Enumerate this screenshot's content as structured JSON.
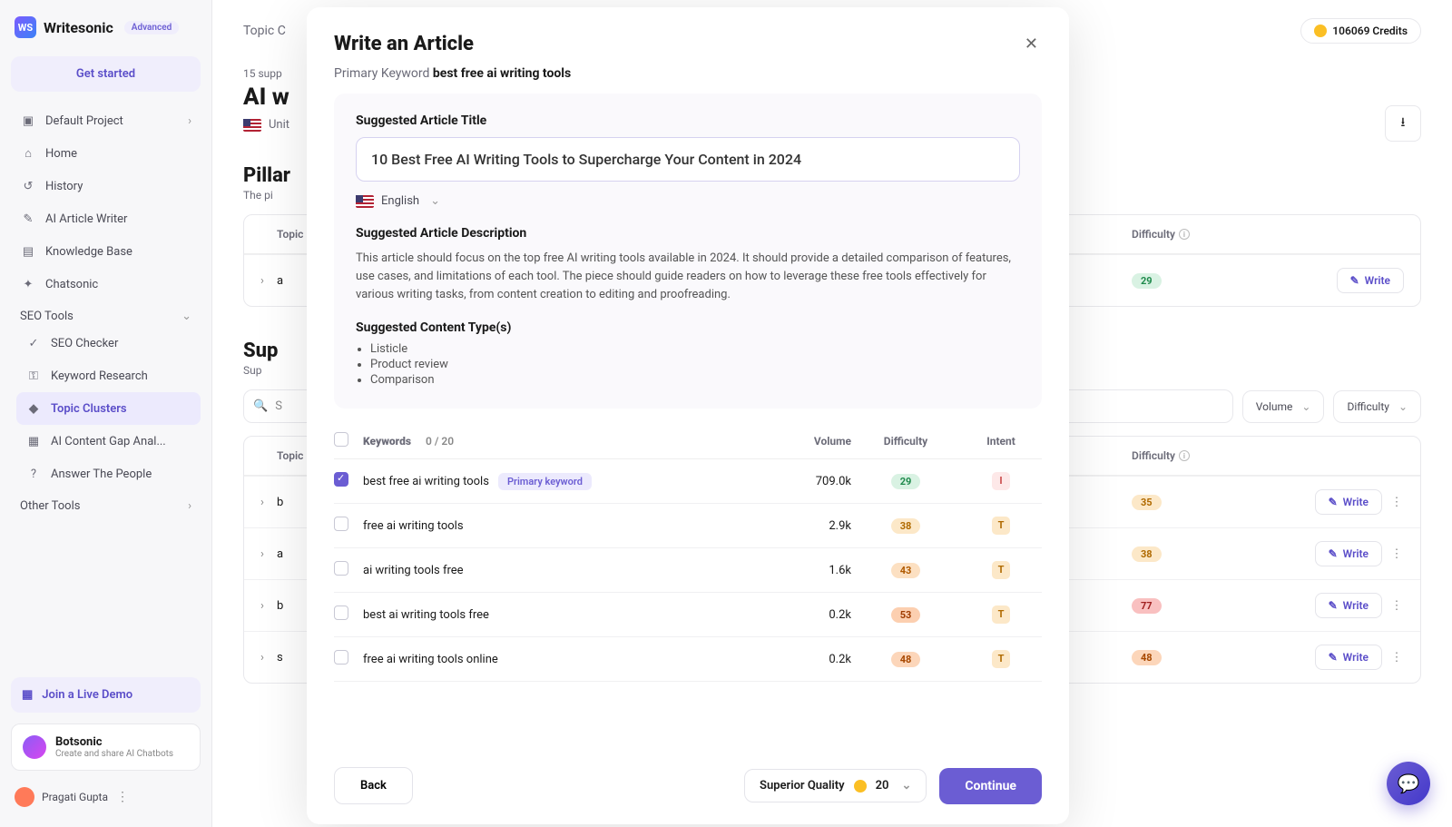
{
  "brand": {
    "name": "Writesonic",
    "badge": "Advanced",
    "logo_initials": "WS"
  },
  "sidebar": {
    "get_started": "Get started",
    "default_project": "Default Project",
    "nav": [
      {
        "label": "Home"
      },
      {
        "label": "History"
      },
      {
        "label": "AI Article Writer"
      },
      {
        "label": "Knowledge Base"
      },
      {
        "label": "Chatsonic"
      }
    ],
    "seo_section": "SEO Tools",
    "seo_items": [
      {
        "label": "SEO Checker"
      },
      {
        "label": "Keyword Research"
      },
      {
        "label": "Topic Clusters",
        "active": true
      },
      {
        "label": "AI Content Gap Anal..."
      },
      {
        "label": "Answer The People"
      }
    ],
    "other_section": "Other Tools",
    "demo": "Join a Live Demo",
    "botsonic": {
      "title": "Botsonic",
      "sub": "Create and share AI Chatbots"
    },
    "user": "Pragati Gupta"
  },
  "page": {
    "breadcrumb": "Topic C",
    "credits": "106069 Credits",
    "meta": "15 supp",
    "title": "AI w",
    "locale": "Unit",
    "pillar_title": "Pillar",
    "pillar_sub": "The pi",
    "th_topic": "Topic",
    "th_kw": "Keywords",
    "th_vol": "Volume",
    "th_diff": "Difficulty",
    "pillar_row": {
      "topic": "a",
      "diff": "29",
      "diff_class": "d-29"
    },
    "supp_title": "Sup",
    "supp_sub": "Sup",
    "search_ph": "S",
    "sort_vol": "Volume",
    "sort_diff": "Difficulty",
    "rows": [
      {
        "topic": "b",
        "diff": "35",
        "diff_class": "d-35"
      },
      {
        "topic": "a",
        "diff": "38",
        "diff_class": "d-38"
      },
      {
        "topic": "b",
        "diff": "77",
        "diff_class": "d-77"
      },
      {
        "topic": "s",
        "diff": "48",
        "diff_class": "d-48"
      }
    ],
    "write_label": "Write"
  },
  "modal": {
    "title": "Write an Article",
    "pk_label": "Primary Keyword",
    "pk_value": "best free ai writing tools",
    "title_label": "Suggested Article Title",
    "title_value": "10 Best Free AI Writing Tools to Supercharge Your Content in 2024",
    "language": "English",
    "desc_label": "Suggested Article Description",
    "desc_text": "This article should focus on the top free AI writing tools available in 2024. It should provide a detailed comparison of features, use cases, and limitations of each tool. The piece should guide readers on how to leverage these free tools effectively for various writing tasks, from content creation to editing and proofreading.",
    "ctype_label": "Suggested Content Type(s)",
    "ctypes": [
      "Listicle",
      "Product review",
      "Comparison"
    ],
    "kw_header": {
      "kw": "Keywords",
      "count": "0 / 20",
      "vol": "Volume",
      "diff": "Difficulty",
      "int": "Intent"
    },
    "keywords": [
      {
        "checked": true,
        "term": "best free ai writing tools",
        "primary": true,
        "vol": "709.0k",
        "diff": "29",
        "diff_class": "d-29",
        "intent": "I",
        "int_class": "int-i"
      },
      {
        "checked": false,
        "term": "free ai writing tools",
        "primary": false,
        "vol": "2.9k",
        "diff": "38",
        "diff_class": "d-38",
        "intent": "T",
        "int_class": "int-t"
      },
      {
        "checked": false,
        "term": "ai writing tools free",
        "primary": false,
        "vol": "1.6k",
        "diff": "43",
        "diff_class": "d-43",
        "intent": "T",
        "int_class": "int-t"
      },
      {
        "checked": false,
        "term": "best ai writing tools free",
        "primary": false,
        "vol": "0.2k",
        "diff": "53",
        "diff_class": "d-53",
        "intent": "T",
        "int_class": "int-t"
      },
      {
        "checked": false,
        "term": "free ai writing tools online",
        "primary": false,
        "vol": "0.2k",
        "diff": "48",
        "diff_class": "d-48",
        "intent": "T",
        "int_class": "int-t"
      }
    ],
    "primary_tag": "Primary keyword",
    "back": "Back",
    "quality_label": "Superior Quality",
    "quality_value": "20",
    "continue": "Continue"
  }
}
